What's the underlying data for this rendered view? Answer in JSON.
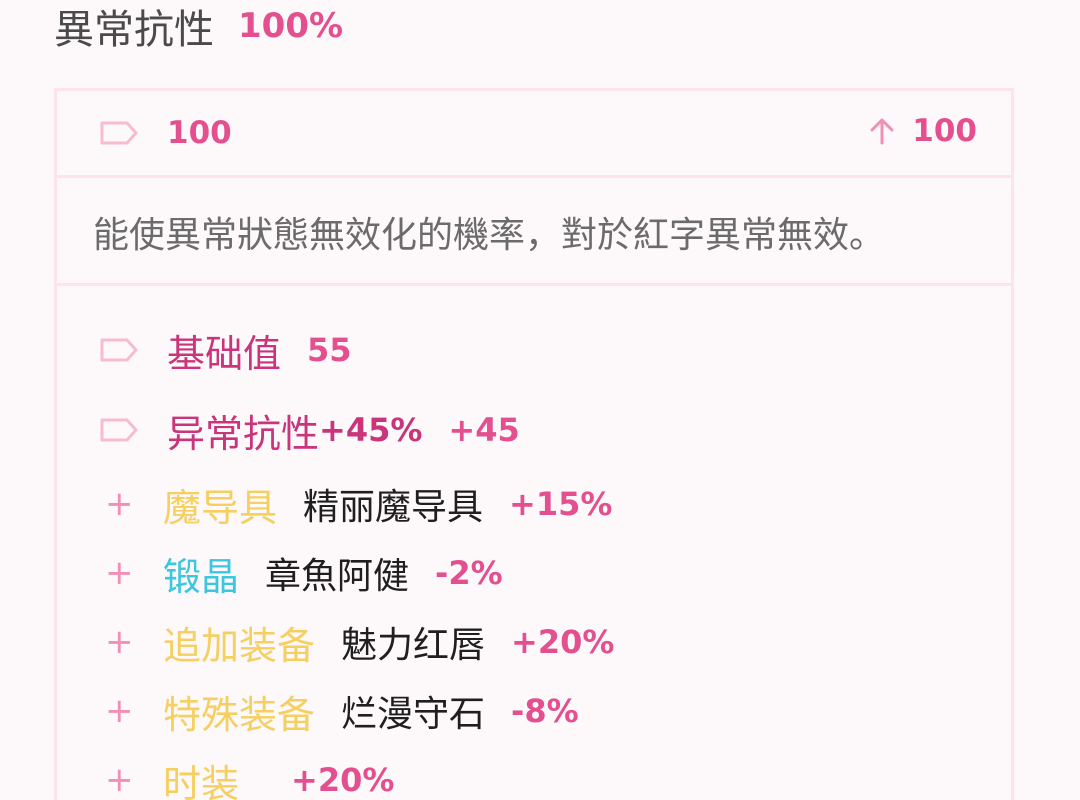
{
  "stat": {
    "name": "異常抗性",
    "value": "100%"
  },
  "header": {
    "value": "100",
    "max_value": "100"
  },
  "description": "能使異常狀態無效化的機率，對於紅字異常無效。",
  "base": {
    "label": "基础值",
    "value": "55"
  },
  "bonus": {
    "label": "异常抗性",
    "percent": "+45%",
    "value": "+45"
  },
  "sources": [
    {
      "type": "魔导具",
      "name": "精丽魔导具",
      "value": "+15%"
    },
    {
      "type": "锻晶",
      "name": "章魚阿健",
      "value": "-2%"
    },
    {
      "type": "追加装备",
      "name": "魅力红唇",
      "value": "+20%"
    },
    {
      "type": "特殊装备",
      "name": "烂漫守石",
      "value": "-8%"
    },
    {
      "type": "时装",
      "name": "",
      "value": "+20%"
    }
  ],
  "colors": {
    "accent": "#e34f8f",
    "border": "#fde3ec",
    "gold": "#f5cf60",
    "cyan": "#3cc6e0"
  },
  "icons": {
    "tag": "tag-icon",
    "arrow": "arrow-up-icon",
    "plus": "plus-icon"
  }
}
